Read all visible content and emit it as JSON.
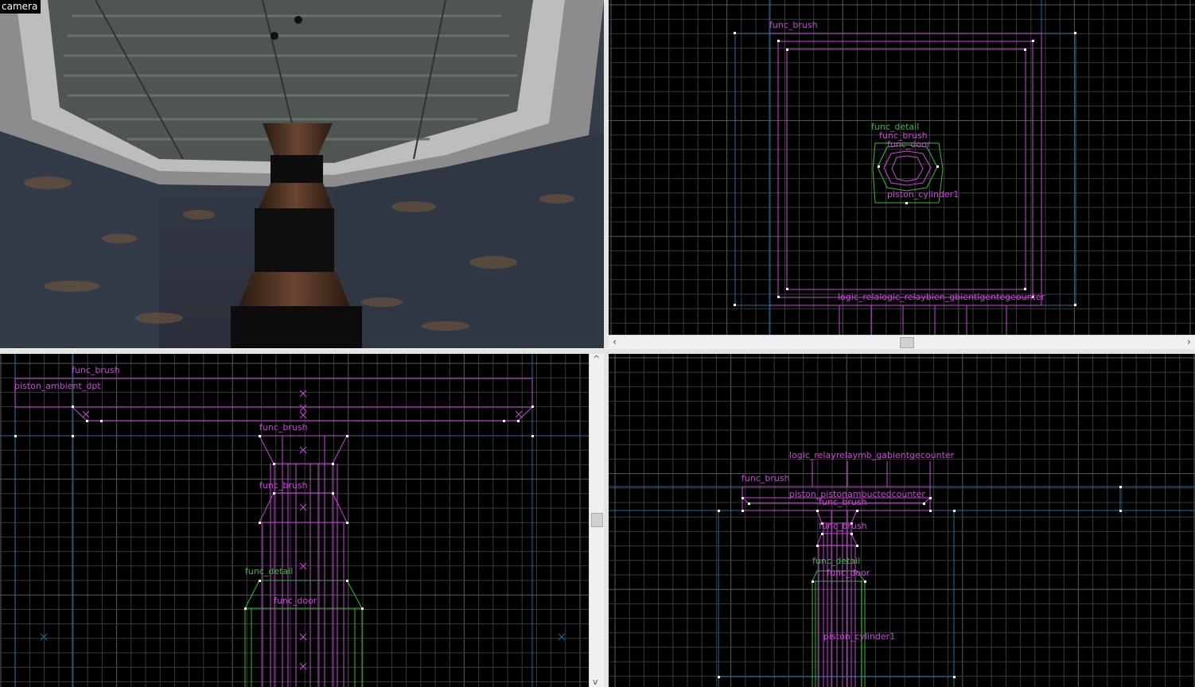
{
  "viewports": {
    "camera": {
      "label": "camera"
    },
    "top": {
      "labels": {
        "func_brush_top": "func_brush",
        "func_detail": "func_detail",
        "func_brush_mid": "func_brush",
        "func_door": "func_door",
        "piston_cylinder": "piston_cylinder1",
        "logic_overlap": "logic_relalogic_relaybien_gbientlgentegeounter"
      }
    },
    "front": {
      "labels": {
        "func_brush_top": "func_brush",
        "piston_overlap": "piston_ambient_dpt",
        "func_brush_2": "func_brush",
        "func_brush_3": "func_brush",
        "func_detail": "func_detail",
        "func_door": "func_door"
      }
    },
    "side": {
      "labels": {
        "logic_overlap": "logic_relayrelaymb_gabientgecounter",
        "func_brush_1": "func_brush",
        "piston_overlap": "piston_pistonambuctedcounter",
        "func_brush_2": "func_brush",
        "func_brush_3": "func_brush",
        "func_detail": "func_detail",
        "func_door": "func_door",
        "piston_cylinder": "piston_cylinder1"
      }
    }
  },
  "scrollbars": {
    "left_arrow": "‹",
    "right_arrow": "›",
    "up_arrow": "^",
    "down_arrow": "v"
  },
  "colors": {
    "grid_minor": "#3a3a3a",
    "grid_major": "#5a5a5a",
    "axis": "#1e6fa0",
    "brush": "#d040e0",
    "detail": "#2fbf2f",
    "vertex": "#ffffff"
  }
}
